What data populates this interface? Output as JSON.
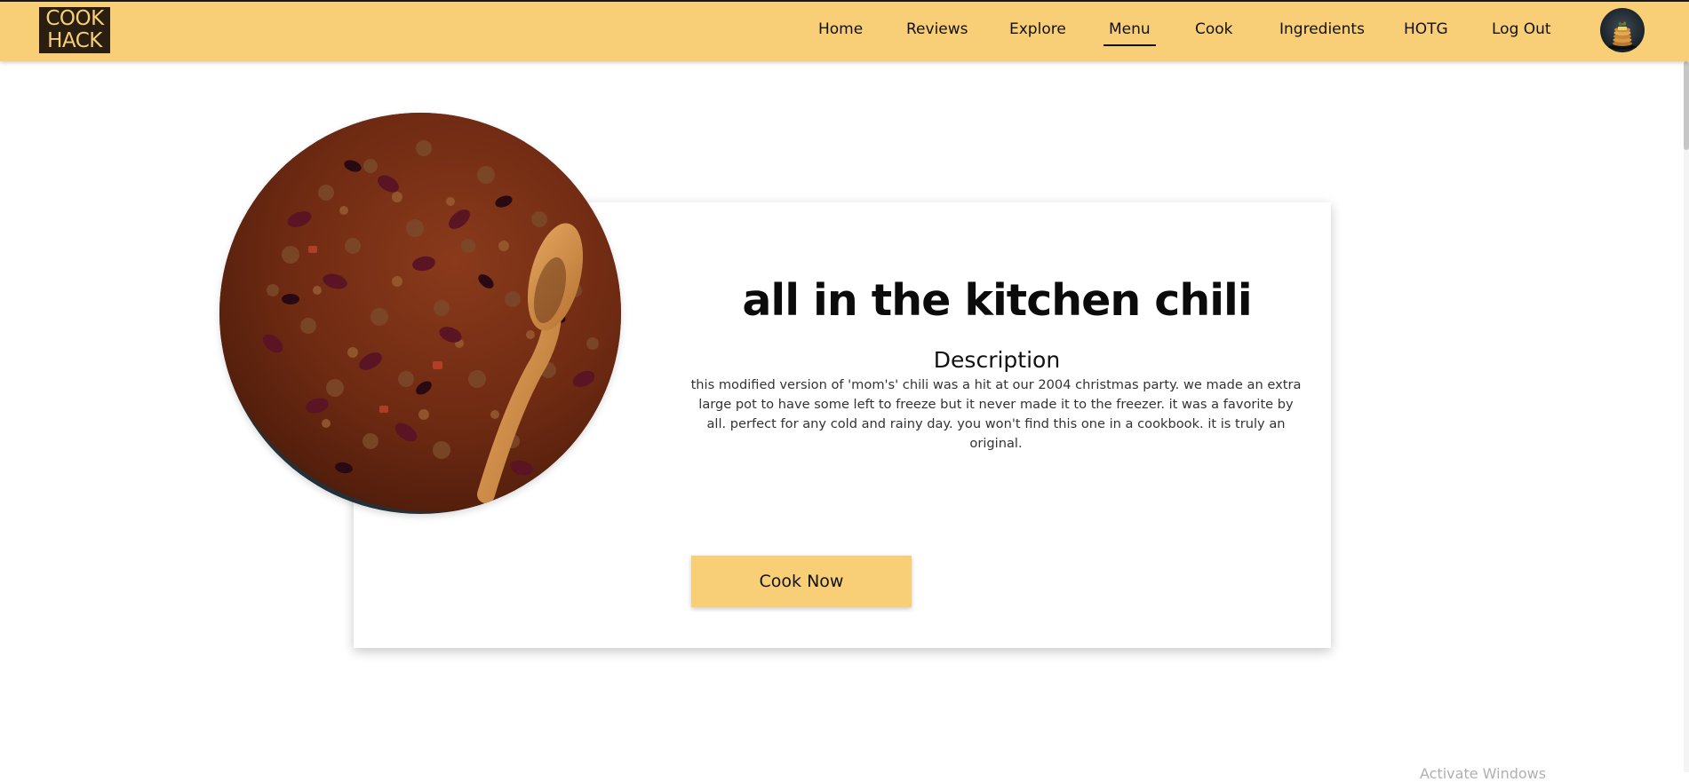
{
  "header": {
    "logo_line1": "COOK",
    "logo_line2": "HACK",
    "nav": [
      {
        "label": "Home",
        "active": false
      },
      {
        "label": "Reviews",
        "active": false
      },
      {
        "label": "Explore",
        "active": false
      },
      {
        "label": "Menu",
        "active": true
      },
      {
        "label": "Cook",
        "active": false
      },
      {
        "label": "Ingredients",
        "active": false
      },
      {
        "label": "HOTG",
        "active": false
      },
      {
        "label": "Log Out",
        "active": false
      }
    ]
  },
  "recipe": {
    "title": "all in the kitchen chili",
    "description_heading": "Description",
    "description": "this modified version of 'mom's' chili was a hit at our 2004 christmas party. we made an extra large pot to have some left to freeze but it never made it to the freezer. it was a favorite by all. perfect for any cold and rainy day. you won't find this one in a cookbook. it is truly an original.",
    "cook_button_label": "Cook Now"
  },
  "overlay": {
    "watermark": "Activate Windows"
  },
  "colors": {
    "brand": "#f8cf76",
    "logo_background": "#2a1e10"
  }
}
